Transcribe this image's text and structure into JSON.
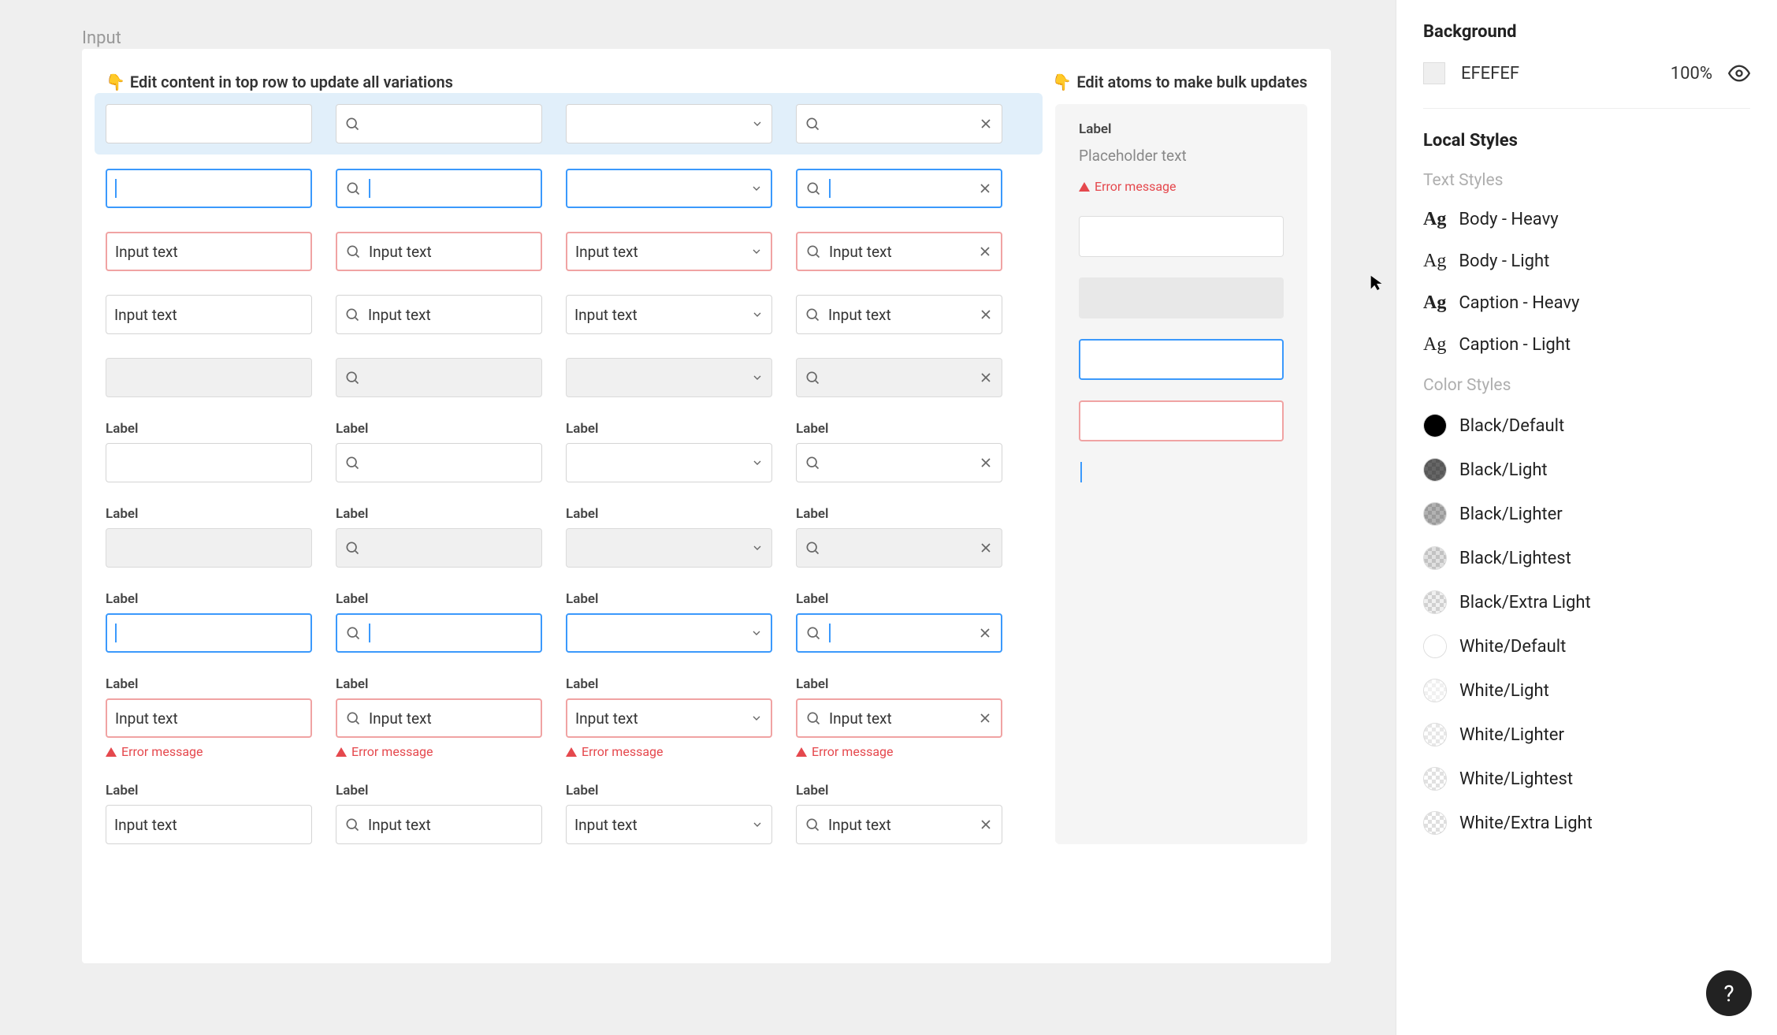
{
  "canvas": {
    "title": "Input",
    "hint_left": "Edit content in top row to update all variations",
    "hint_right": "Edit atoms to make bulk updates"
  },
  "atoms": {
    "label": "Label",
    "placeholder": "Placeholder text",
    "error": "Error message"
  },
  "input_examples": {
    "label": "Label",
    "input_text": "Input text",
    "error_message": "Error message"
  },
  "right_panel": {
    "background_title": "Background",
    "background_hex": "EFEFEF",
    "background_opacity": "100%",
    "local_styles_title": "Local Styles",
    "text_styles_header": "Text Styles",
    "text_styles": [
      {
        "name": "Body - Heavy",
        "weight": "heavy"
      },
      {
        "name": "Body - Light",
        "weight": "light"
      },
      {
        "name": "Caption - Heavy",
        "weight": "heavy"
      },
      {
        "name": "Caption - Light",
        "weight": "light"
      }
    ],
    "color_styles_header": "Color Styles",
    "color_styles": [
      {
        "name": "Black/Default",
        "overlay": "rgba(0,0,0,1)",
        "checker": false
      },
      {
        "name": "Black/Light",
        "overlay": "rgba(0,0,0,0.6)",
        "checker": true
      },
      {
        "name": "Black/Lighter",
        "overlay": "rgba(0,0,0,0.3)",
        "checker": true
      },
      {
        "name": "Black/Lightest",
        "overlay": "rgba(0,0,0,0.12)",
        "checker": true
      },
      {
        "name": "Black/Extra Light",
        "overlay": "rgba(0,0,0,0.06)",
        "checker": true
      },
      {
        "name": "White/Default",
        "overlay": "rgba(255,255,255,1)",
        "checker": false
      },
      {
        "name": "White/Light",
        "overlay": "rgba(255,255,255,0.6)",
        "checker": true
      },
      {
        "name": "White/Lighter",
        "overlay": "rgba(255,255,255,0.3)",
        "checker": true
      },
      {
        "name": "White/Lightest",
        "overlay": "rgba(255,255,255,0.12)",
        "checker": true
      },
      {
        "name": "White/Extra Light",
        "overlay": "rgba(255,255,255,0.06)",
        "checker": true
      }
    ]
  },
  "help": "?"
}
